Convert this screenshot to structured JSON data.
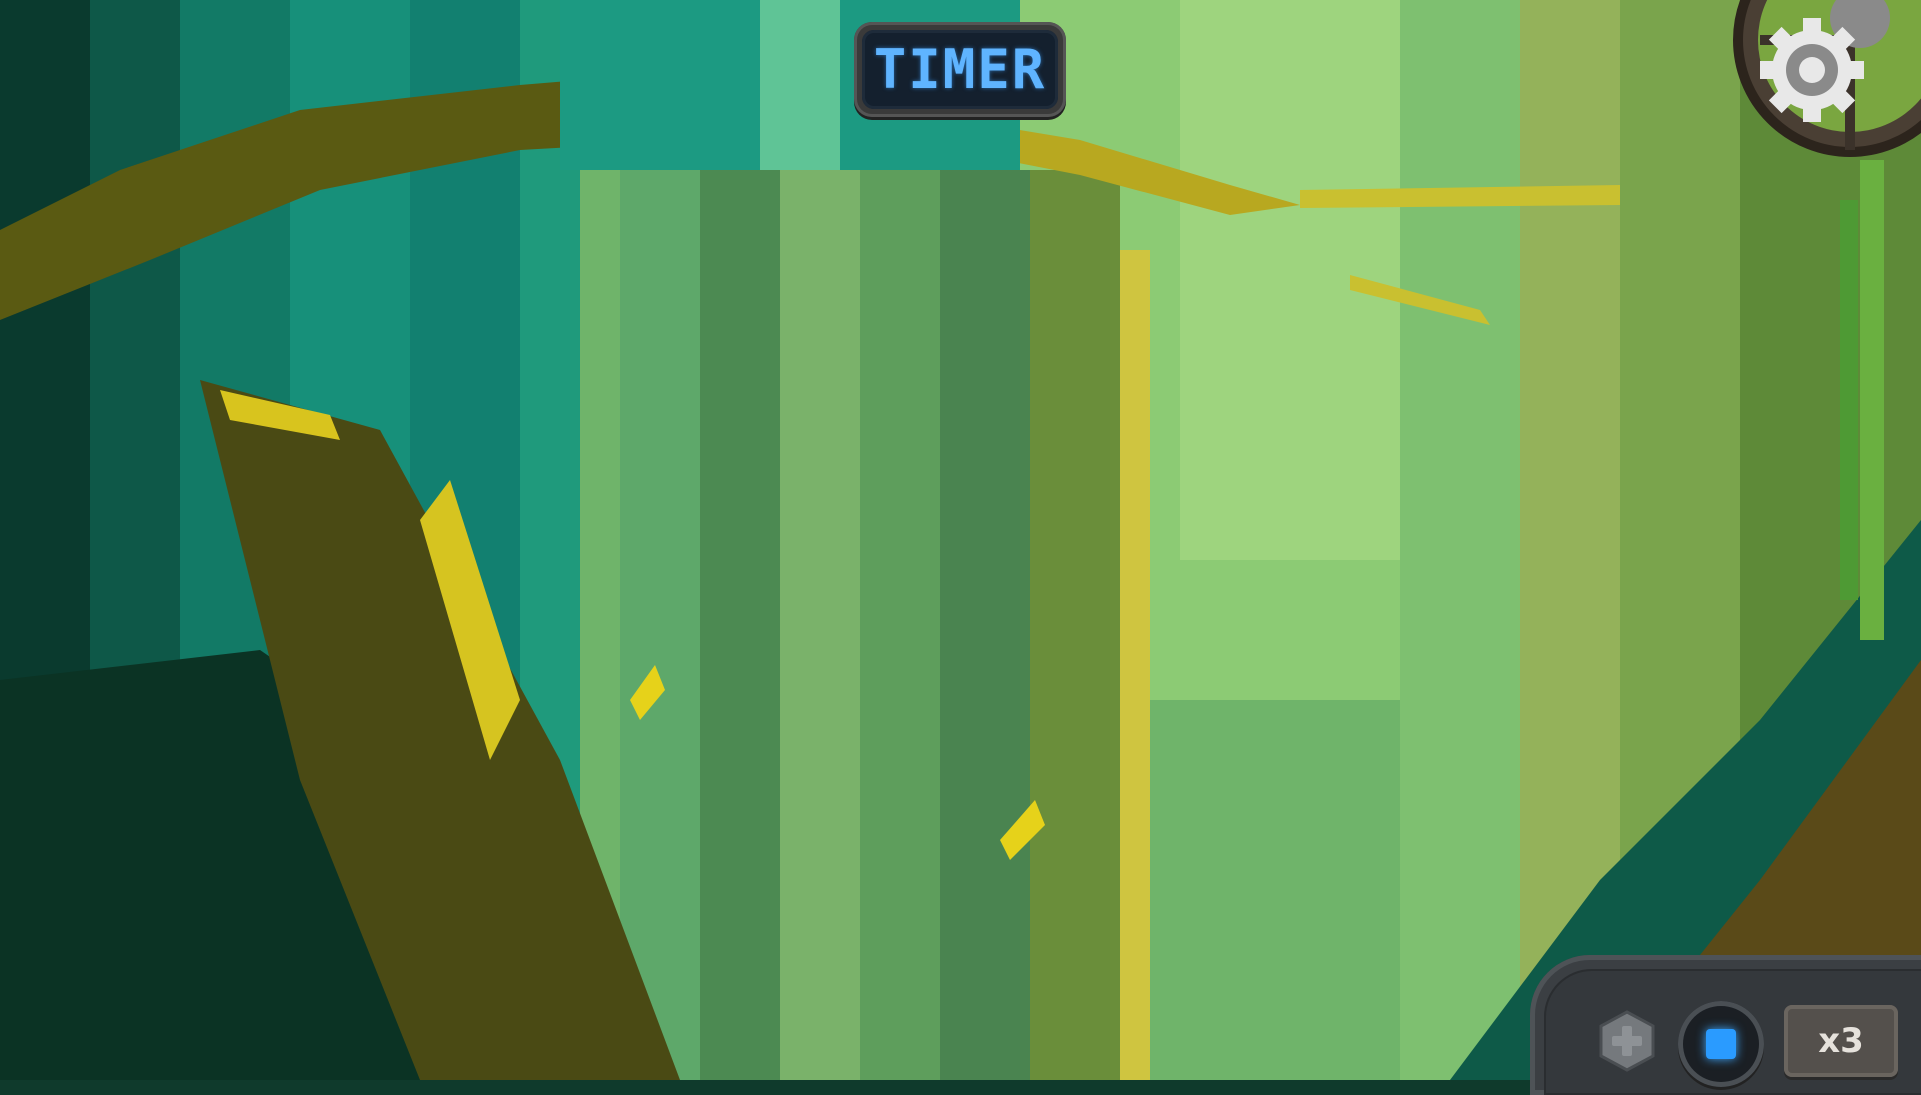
{
  "hud": {
    "timer_label": "TIMER",
    "multiplier_label": "x3"
  },
  "icons": {
    "settings": "gear-icon",
    "bolt": "hex-bolt-icon",
    "stop": "stop-icon"
  },
  "colors": {
    "timer_text": "#5fb4ff",
    "stop_button": "#2a9bff",
    "foliage_light": "#84c870",
    "branch_highlight": "#e6d21a"
  }
}
